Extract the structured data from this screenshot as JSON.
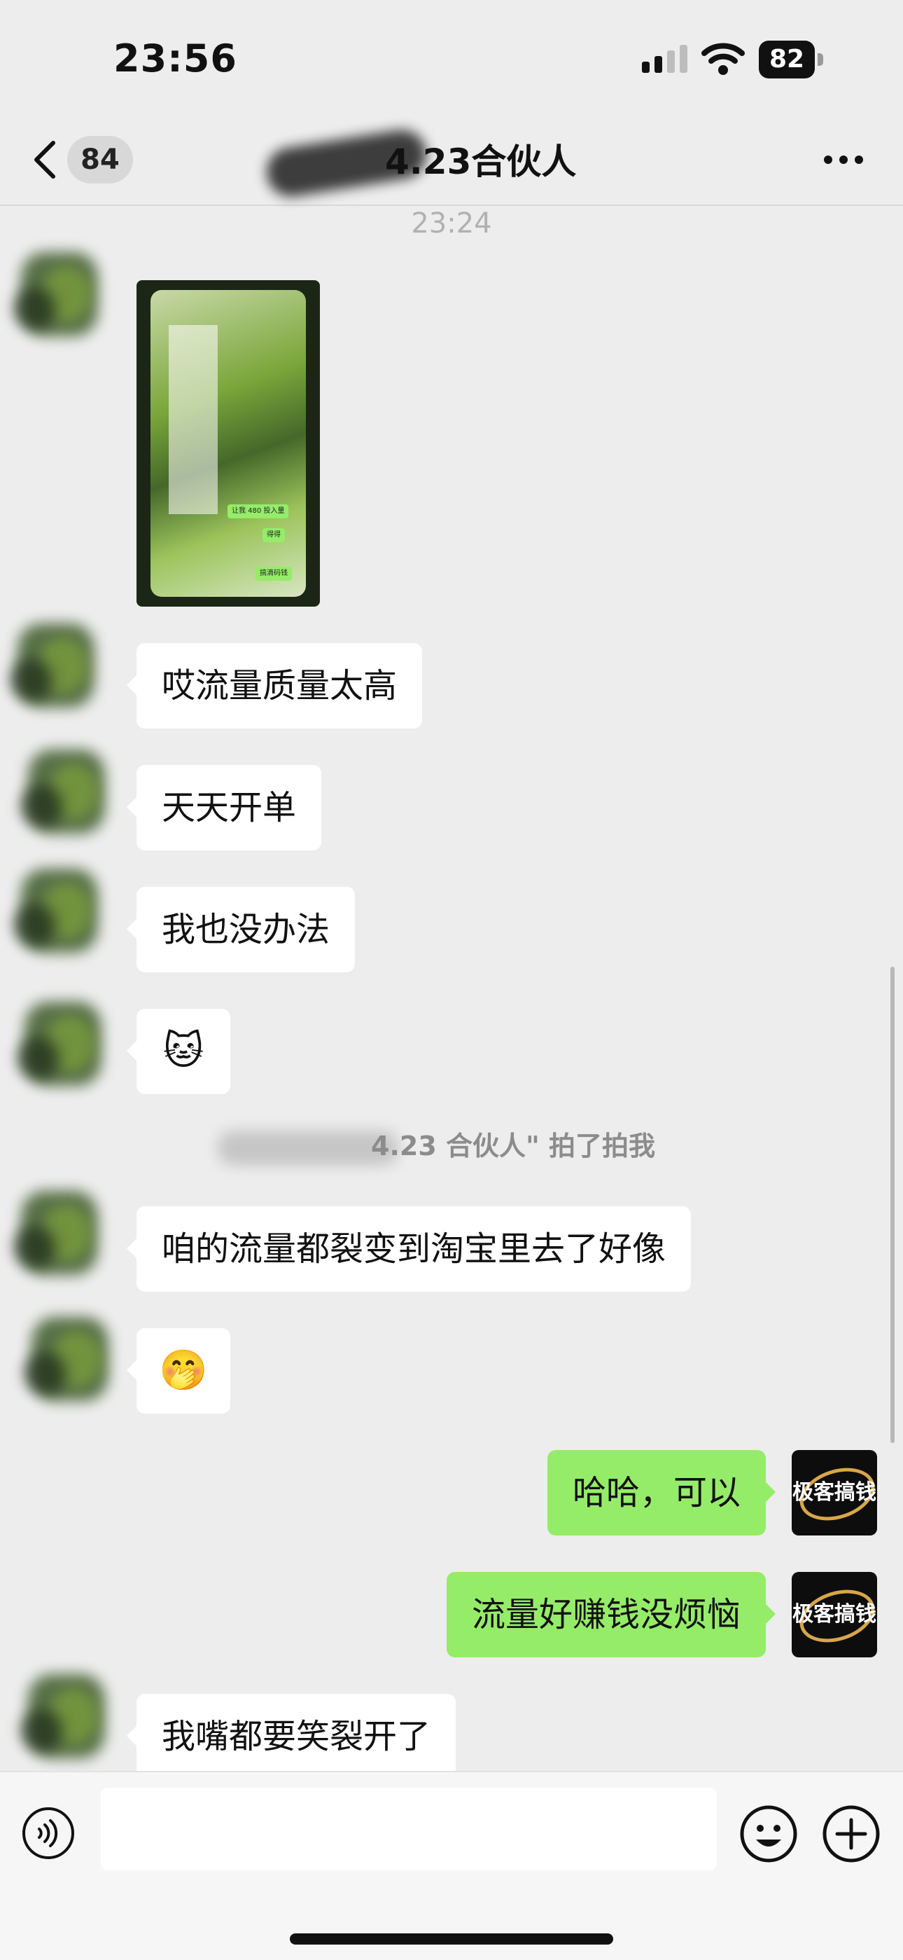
{
  "status_bar": {
    "time": "23:56",
    "battery": "82"
  },
  "nav": {
    "back_badge": "84",
    "title": "4.23合伙人"
  },
  "chat": {
    "timestamp": "23:24",
    "image_message": {
      "bubble_1": "让我 480 投入量",
      "bubble_2": "得得",
      "bubble_3": "搞滴码钱"
    },
    "messages": [
      {
        "from": "other",
        "text": "哎流量质量太高"
      },
      {
        "from": "other",
        "text": "天天开单"
      },
      {
        "from": "other",
        "text": "我也没办法"
      },
      {
        "from": "other",
        "text": "🐱"
      },
      {
        "from": "other",
        "text": "咱的流量都裂变到淘宝里去了好像"
      },
      {
        "from": "other",
        "text": "🤭"
      },
      {
        "from": "self",
        "text": "哈哈，可以"
      },
      {
        "from": "self",
        "text": "流量好赚钱没烦恼"
      },
      {
        "from": "other",
        "text": "我嘴都要笑裂开了"
      }
    ],
    "system_tip": "4.23 合伙人\" 拍了拍我",
    "self_avatar_text": "极客搞钱"
  },
  "input": {
    "placeholder": ""
  },
  "colors": {
    "self_bubble": "#95ec69",
    "other_bubble": "#ffffff",
    "background": "#ededed"
  }
}
